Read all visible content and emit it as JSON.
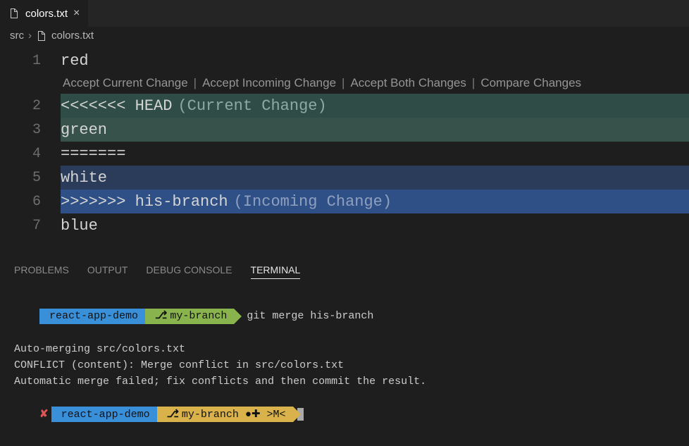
{
  "tab": {
    "filename": "colors.txt"
  },
  "breadcrumb": {
    "folder": "src",
    "file": "colors.txt"
  },
  "codelens": {
    "accept_current": "Accept Current Change",
    "accept_incoming": "Accept Incoming Change",
    "accept_both": "Accept Both Changes",
    "compare": "Compare Changes"
  },
  "editor": {
    "lines": {
      "l1": {
        "num": "1",
        "text": "red"
      },
      "l2": {
        "num": "2",
        "marker": "<<<<<<< HEAD",
        "annot": "(Current Change)"
      },
      "l3": {
        "num": "3",
        "text": "green"
      },
      "l4": {
        "num": "4",
        "text": "======="
      },
      "l5": {
        "num": "5",
        "text": "white"
      },
      "l6": {
        "num": "6",
        "marker": ">>>>>>> his-branch",
        "annot": "(Incoming Change)"
      },
      "l7": {
        "num": "7",
        "text": "blue"
      }
    }
  },
  "panel": {
    "problems": "PROBLEMS",
    "output": "OUTPUT",
    "debug": "DEBUG CONSOLE",
    "terminal": "TERMINAL"
  },
  "terminal": {
    "prompt1": {
      "dir": "react-app-demo",
      "branch": "my-branch",
      "cmd": "git merge his-branch"
    },
    "out1": "Auto-merging src/colors.txt",
    "out2": "CONFLICT (content): Merge conflict in src/colors.txt",
    "out3": "Automatic merge failed; fix conflicts and then commit the result.",
    "prompt2": {
      "dir": "react-app-demo",
      "branch_status": "my-branch ●✚ >M<"
    }
  }
}
